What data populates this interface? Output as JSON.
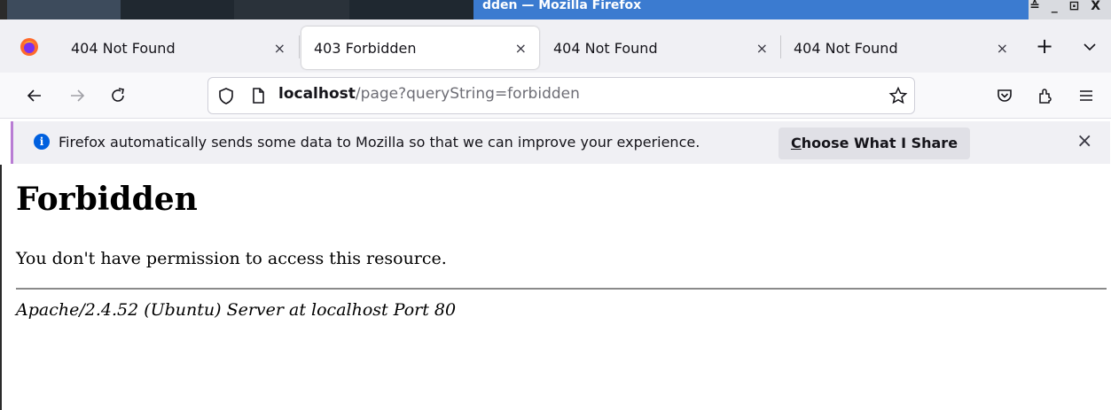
{
  "window": {
    "title": "dden — Mozilla Firefox",
    "controls": "≙ _ ⊡ X"
  },
  "tabs": [
    {
      "label": "404 Not Found",
      "close": "×"
    },
    {
      "label": "403 Forbidden",
      "close": "×",
      "active": true
    },
    {
      "label": "404 Not Found",
      "close": "×"
    },
    {
      "label": "404 Not Found",
      "close": "×"
    }
  ],
  "toolbar": {
    "new_tab": "+",
    "url_host": "localhost",
    "url_rest": "/page?queryString=forbidden"
  },
  "notification": {
    "message": "Firefox automatically sends some data to Mozilla so that we can improve your experience.",
    "button_first": "C",
    "button_rest": "hoose What I Share",
    "close": "×"
  },
  "page": {
    "heading": "Forbidden",
    "message": "You don't have permission to access this resource.",
    "address": "Apache/2.4.52 (Ubuntu) Server at localhost Port 80"
  },
  "colors": {
    "accent": "#0060df",
    "notification_border": "#b97dd4",
    "titlebar_active": "#3b7bd0"
  }
}
